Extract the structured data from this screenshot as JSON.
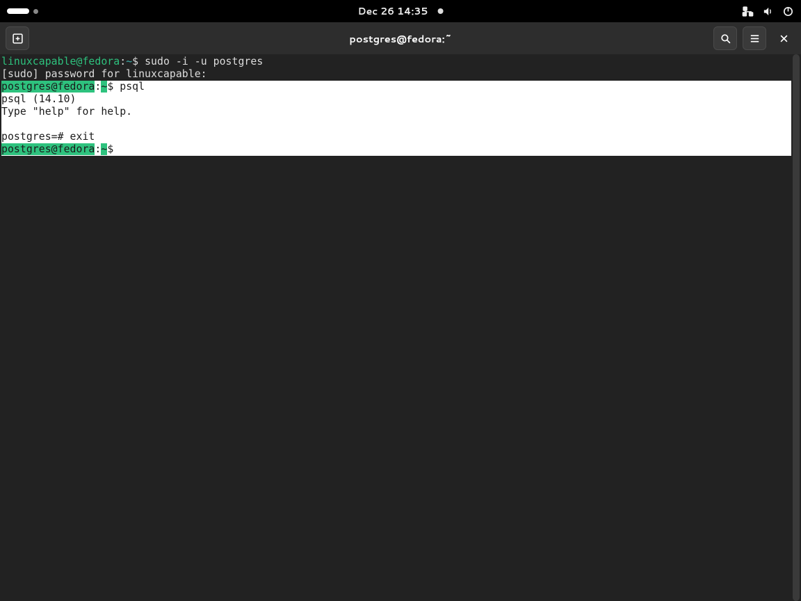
{
  "panel": {
    "datetime": "Dec 26  14:35"
  },
  "window": {
    "title": "postgres@fedora:~"
  },
  "terminal": {
    "line1": {
      "user": "linuxcapable@fedora",
      "sep": ":",
      "tilde": "~",
      "cmd": "$ sudo -i -u postgres"
    },
    "line2": "[sudo] password for linuxcapable:",
    "line3": {
      "user": "postgres@fedora",
      "sep": ":",
      "tilde": "~",
      "cmd": "$ psql"
    },
    "line4": "psql (14.10)",
    "line5": "Type \"help\" for help.",
    "line6_blank": "",
    "line7": "postgres=# exit",
    "line8": {
      "user": "postgres@fedora",
      "sep": ":",
      "tilde": "~",
      "cmd": "$ "
    }
  }
}
